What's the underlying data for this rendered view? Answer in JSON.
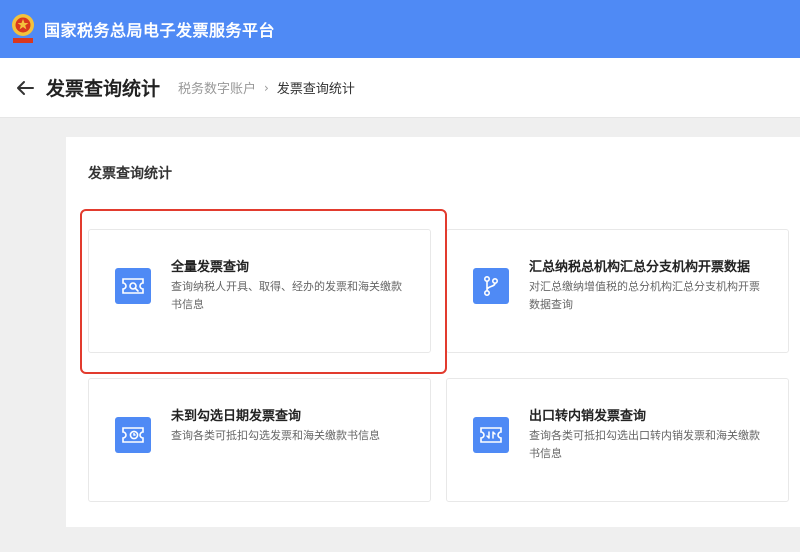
{
  "app": {
    "title": "国家税务总局电子发票服务平台"
  },
  "header": {
    "page_title": "发票查询统计",
    "breadcrumb": {
      "parent": "税务数字账户",
      "current": "发票查询统计"
    }
  },
  "panel": {
    "title": "发票查询统计",
    "cards": [
      {
        "title": "全量发票查询",
        "desc_lines": [
          "查询纳税人开具、取得、经办的发票和海关缴款",
          "书信息"
        ],
        "icon": "invoice-search-icon"
      },
      {
        "title": "汇总纳税总机构汇总分支机构开票数据",
        "desc_lines": [
          "对汇总缴纳增值税的总分机构汇总分支机构开票",
          "数据查询"
        ],
        "icon": "branch-icon"
      },
      {
        "title": "未到勾选日期发票查询",
        "desc_lines": [
          "查询各类可抵扣勾选发票和海关缴款书信息"
        ],
        "icon": "invoice-clock-icon"
      },
      {
        "title": "出口转内销发票查询",
        "desc_lines": [
          "查询各类可抵扣勾选出口转内销发票和海关缴款",
          "书信息"
        ],
        "icon": "invoice-return-icon"
      }
    ]
  },
  "colors": {
    "brand": "#4f8af5",
    "highlight": "#e23b2e"
  }
}
